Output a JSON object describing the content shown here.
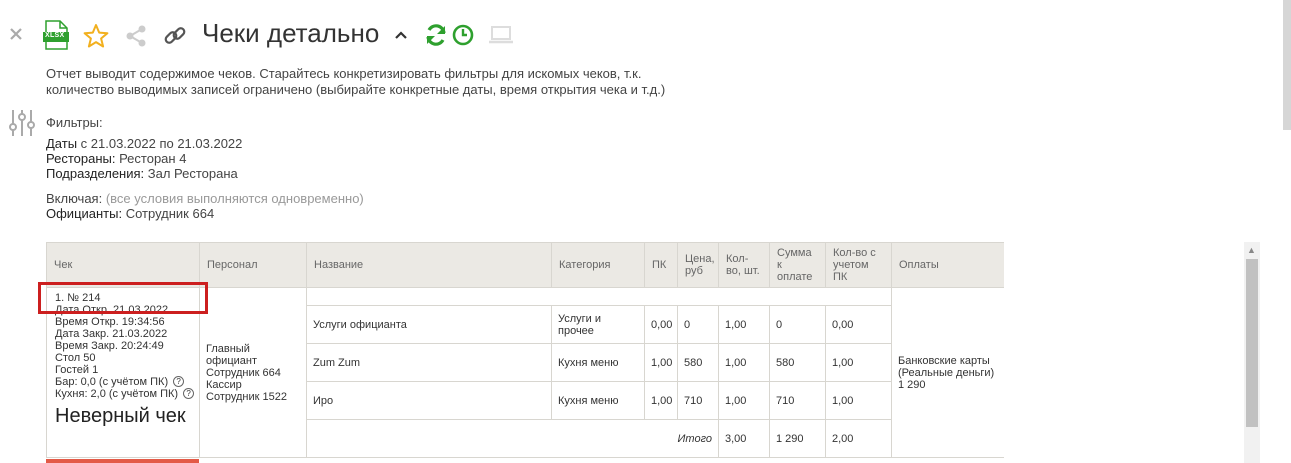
{
  "toolbar": {
    "close_icon": "close-icon",
    "xlsx_label": "XLSX",
    "star_icon": "star-icon",
    "share_icon": "share-icon",
    "link_icon": "link-icon",
    "title": "Чеки детально",
    "collapse_icon": "chevron-up-icon",
    "refresh_icon": "refresh-icon",
    "clock_icon": "clock-icon",
    "laptop_icon": "laptop-icon",
    "accent_green": "#2ea02e",
    "star_color": "#f2b01e"
  },
  "description": {
    "line1": "Отчет выводит содержимое чеков. Старайтесь конкретизировать фильтры для искомых чеков, т.к.",
    "line2": "количество выводимых записей ограничено (выбирайте конкретные даты, время открытия чека и т.д.)"
  },
  "filters": {
    "header": "Фильтры:",
    "dates_label": "Даты",
    "dates_value": " с 21.03.2022 по 21.03.2022",
    "restaurants_label": "Рестораны:",
    "restaurants_value": " Ресторан 4",
    "divisions_label": "Подразделения:",
    "divisions_value": " Зал Ресторана",
    "including_label": "Включая:",
    "including_note": " (все условия выполняются одновременно)",
    "waiters_label": "Официанты:",
    "waiters_value": " Сотрудник 664"
  },
  "table": {
    "headers": {
      "check": "Чек",
      "staff": "Персонал",
      "name": "Название",
      "category": "Категория",
      "pk": "ПК",
      "price": "Цена, руб",
      "qty": "Кол-во, шт.",
      "sum": "Сумма к оплате",
      "qty_pk": "Кол-во с учетом ПК",
      "payments": "Оплаты"
    },
    "check": {
      "number": "1. № 214",
      "date_open": "Дата Откр. 21.03.2022",
      "time_open": "Время Откр. 19:34:56",
      "date_close": "Дата Закр. 21.03.2022",
      "time_close": "Время Закр. 20:24:49",
      "table": "Стол 50",
      "guests": "Гостей 1",
      "bar": "Бар: 0,0 (с учётом ПК)",
      "kitchen": "Кухня: 2,0 (с учётом ПК)",
      "status": "Неверный чек"
    },
    "staff": {
      "line1": "Главный официант",
      "line2": "Сотрудник 664",
      "line3": "Кассир",
      "line4": "Сотрудник 1522"
    },
    "rows": [
      {
        "name": "Услуги официанта",
        "category": "Услуги и прочее",
        "pk": "0,00",
        "price": "0",
        "qty": "1,00",
        "sum": "0",
        "qty_pk": "0,00"
      },
      {
        "name": "Zum Zum",
        "category": "Кухня меню",
        "pk": "1,00",
        "price": "580",
        "qty": "1,00",
        "sum": "580",
        "qty_pk": "1,00"
      },
      {
        "name": "Иро",
        "category": "Кухня меню",
        "pk": "1,00",
        "price": "710",
        "qty": "1,00",
        "sum": "710",
        "qty_pk": "1,00"
      }
    ],
    "total": {
      "label": "Итого",
      "qty": "3,00",
      "sum": "1 290",
      "qty_pk": "2,00"
    },
    "payments": {
      "line1": "Банковские карты",
      "line2": "(Реальные деньги)",
      "line3": "1 290"
    }
  }
}
